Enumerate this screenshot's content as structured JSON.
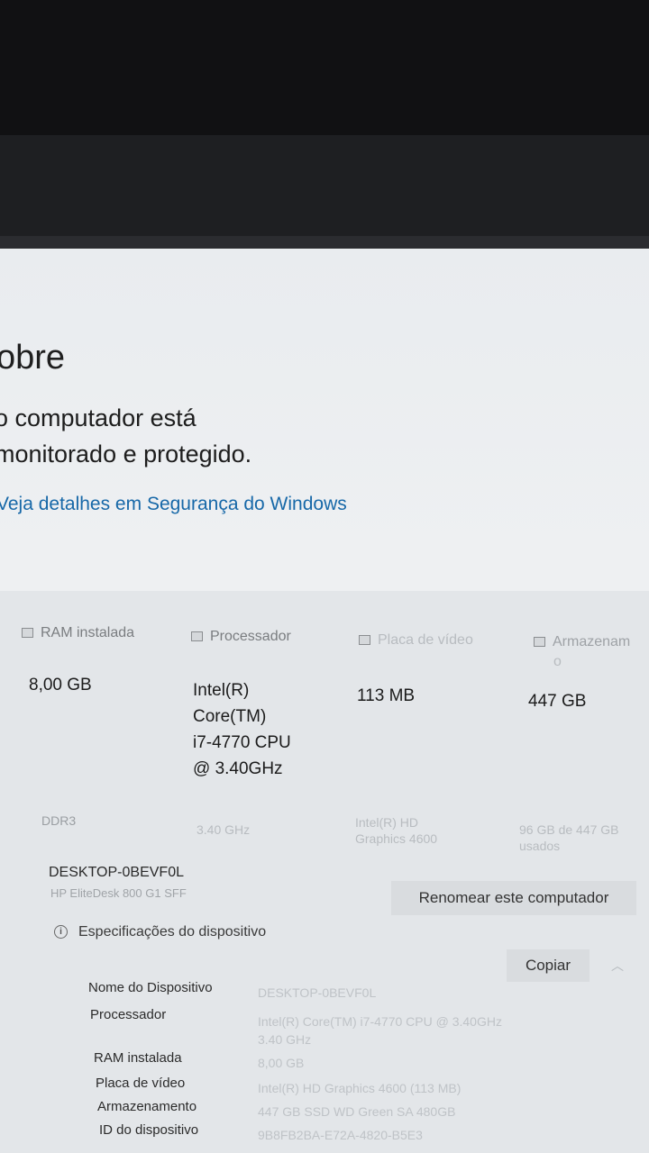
{
  "page": {
    "title": "obre"
  },
  "protection": {
    "line1": "o computador está",
    "line2": "monitorado e protegido.",
    "link": "Veja detalhes em Segurança do Windows"
  },
  "specs": {
    "ram": {
      "heading": "RAM instalada",
      "value": "8,00 GB",
      "sub": "DDR3"
    },
    "cpu": {
      "heading": "Processador",
      "value_lines": [
        "Intel(R)",
        "Core(TM)",
        "i7-4770 CPU",
        "@ 3.40GHz"
      ],
      "sub": "3.40 GHz"
    },
    "gpu": {
      "heading": "Placa de vídeo",
      "value": "113 MB",
      "sub_lines": [
        "Intel(R) HD",
        "Graphics 4600"
      ]
    },
    "storage": {
      "heading": "Armazenam",
      "heading_wrap": "o",
      "value": "447 GB",
      "sub_lines": [
        "96 GB de 447 GB",
        "usados"
      ]
    }
  },
  "device": {
    "name": "DESKTOP-0BEVF0L",
    "model": "HP EliteDesk 800 G1 SFF",
    "rename_label": "Renomear este computador"
  },
  "device_specs": {
    "heading": "Especificações do dispositivo",
    "copy_label": "Copiar",
    "rows": [
      {
        "label": "Nome do Dispositivo",
        "value": "DESKTOP-0BEVF0L"
      },
      {
        "label": "Processador",
        "value": "Intel(R) Core(TM) i7-4770 CPU @ 3.40GHz",
        "value2": "3.40 GHz"
      },
      {
        "label": "RAM instalada",
        "value": "8,00 GB"
      },
      {
        "label": "Placa de vídeo",
        "value": "Intel(R) HD Graphics 4600 (113 MB)"
      },
      {
        "label": "Armazenamento",
        "value": "447 GB SSD WD Green SA 480GB"
      },
      {
        "label": "ID do dispositivo",
        "value": "9B8FB2BA-E72A-4820-B5E3"
      }
    ]
  }
}
